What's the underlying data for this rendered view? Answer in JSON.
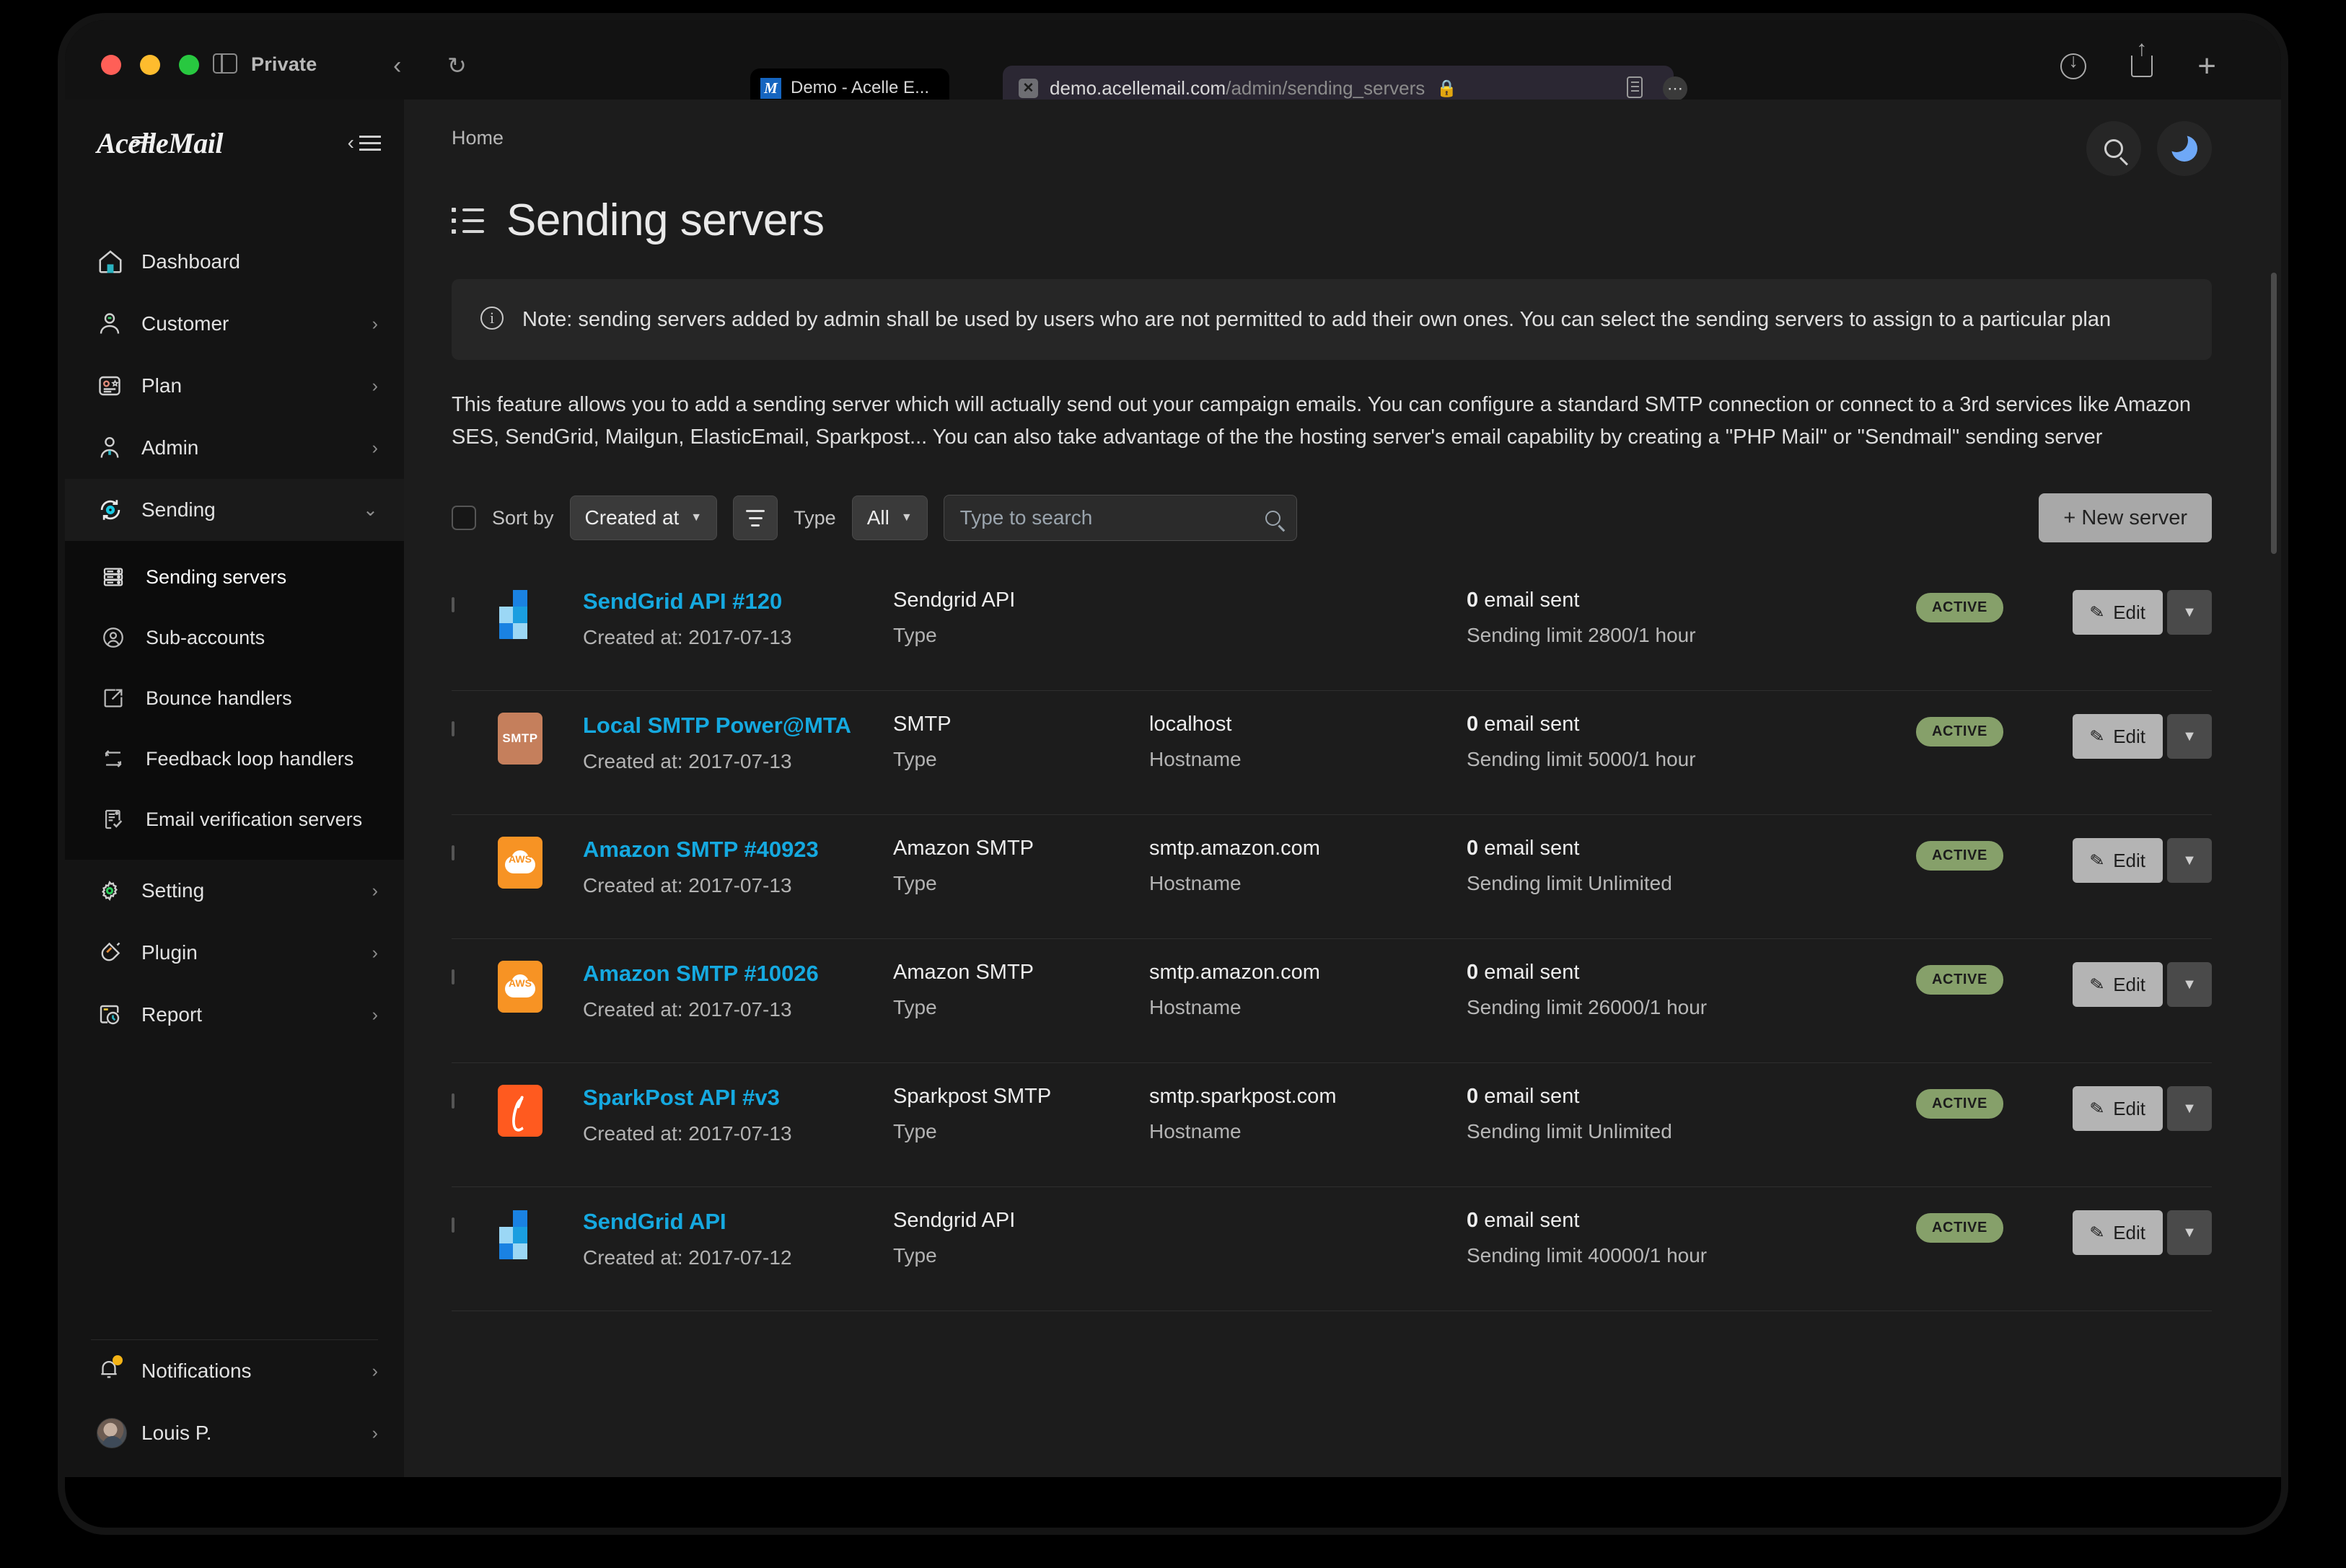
{
  "browser": {
    "private_label": "Private",
    "back_icon": "chevron-left-icon",
    "reload_icon": "reload-icon",
    "tab": {
      "title": "Demo - Acelle E...",
      "favicon_letter": "M"
    },
    "url": {
      "domain": "demo.acellemail.com",
      "path": "/admin/sending_servers",
      "lock_icon": "lock-icon"
    },
    "right_icons": [
      "download-icon",
      "share-icon",
      "plus-icon"
    ]
  },
  "sidebar": {
    "logo": "AcelleMail",
    "collapse_icon": "collapse-sidebar-icon",
    "items": [
      {
        "label": "Dashboard",
        "icon": "home-icon",
        "arrow": ""
      },
      {
        "label": "Customer",
        "icon": "user-icon",
        "arrow": "›"
      },
      {
        "label": "Plan",
        "icon": "plan-card-icon",
        "arrow": "›"
      },
      {
        "label": "Admin",
        "icon": "admin-user-icon",
        "arrow": "›"
      },
      {
        "label": "Sending",
        "icon": "sending-sync-icon",
        "arrow": "⌄"
      }
    ],
    "sub_items": [
      {
        "label": "Sending servers",
        "icon": "server-icon",
        "active": true
      },
      {
        "label": "Sub-accounts",
        "icon": "account-circle-icon",
        "active": false
      },
      {
        "label": "Bounce handlers",
        "icon": "bounce-icon",
        "active": false
      },
      {
        "label": "Feedback loop handlers",
        "icon": "loop-icon",
        "active": false
      },
      {
        "label": "Email verification servers",
        "icon": "verify-icon",
        "active": false
      }
    ],
    "items_after": [
      {
        "label": "Setting",
        "icon": "gear-icon",
        "arrow": "›"
      },
      {
        "label": "Plugin",
        "icon": "plug-icon",
        "arrow": "›"
      },
      {
        "label": "Report",
        "icon": "report-clock-icon",
        "arrow": "›"
      }
    ],
    "footer": [
      {
        "label": "Notifications",
        "icon": "bell-icon",
        "arrow": "›",
        "dot": true
      },
      {
        "label": "Louis P.",
        "icon": "avatar",
        "arrow": "›",
        "dot": false
      }
    ]
  },
  "header": {
    "breadcrumb": "Home",
    "title": "Sending servers",
    "title_icon": "list-icon",
    "search_icon": "search-icon",
    "theme_icon": "moon-icon"
  },
  "note": {
    "icon": "info-icon",
    "text": "Note: sending servers added by admin shall be used by users who are not permitted to add their own ones. You can select the sending servers to assign to a particular plan"
  },
  "intro": "This feature allows you to add a sending server which will actually send out your campaign emails. You can configure a standard SMTP connection or connect to a 3rd services like Amazon SES, SendGrid, Mailgun, ElasticEmail, Sparkpost... You can also take advantage of the the hosting server's email capability by creating a \"PHP Mail\" or \"Sendmail\" sending server",
  "toolbar": {
    "select_all_checkbox": "",
    "sort_by_label": "Sort by",
    "sort_by_value": "Created at",
    "sort_dir_icon": "sort-descending-icon",
    "type_label": "Type",
    "type_value": "All",
    "search_placeholder": "Type to search",
    "search_icon": "search-icon",
    "new_server_label": "+ New server"
  },
  "table": {
    "rows": [
      {
        "name": "SendGrid API #120",
        "created": "Created at: 2017-07-13",
        "type_value": "Sendgrid API",
        "type_label": "Type",
        "host_value": "",
        "host_label": "",
        "sent": "0",
        "sent_label": "email sent",
        "limit": "Sending limit 2800/1 hour",
        "status": "ACTIVE",
        "edit_label": "Edit",
        "logo": "sendgrid"
      },
      {
        "name": "Local SMTP Power@MTA",
        "created": "Created at: 2017-07-13",
        "type_value": "SMTP",
        "type_label": "Type",
        "host_value": "localhost",
        "host_label": "Hostname",
        "sent": "0",
        "sent_label": "email sent",
        "limit": "Sending limit 5000/1 hour",
        "status": "ACTIVE",
        "edit_label": "Edit",
        "logo": "smtp"
      },
      {
        "name": "Amazon SMTP #40923",
        "created": "Created at: 2017-07-13",
        "type_value": "Amazon SMTP",
        "type_label": "Type",
        "host_value": "smtp.amazon.com",
        "host_label": "Hostname",
        "sent": "0",
        "sent_label": "email sent",
        "limit": "Sending limit Unlimited",
        "status": "ACTIVE",
        "edit_label": "Edit",
        "logo": "aws"
      },
      {
        "name": "Amazon SMTP #10026",
        "created": "Created at: 2017-07-13",
        "type_value": "Amazon SMTP",
        "type_label": "Type",
        "host_value": "smtp.amazon.com",
        "host_label": "Hostname",
        "sent": "0",
        "sent_label": "email sent",
        "limit": "Sending limit 26000/1 hour",
        "status": "ACTIVE",
        "edit_label": "Edit",
        "logo": "aws"
      },
      {
        "name": "SparkPost API #v3",
        "created": "Created at: 2017-07-13",
        "type_value": "Sparkpost SMTP",
        "type_label": "Type",
        "host_value": "smtp.sparkpost.com",
        "host_label": "Hostname",
        "sent": "0",
        "sent_label": "email sent",
        "limit": "Sending limit Unlimited",
        "status": "ACTIVE",
        "edit_label": "Edit",
        "logo": "sparkpost"
      },
      {
        "name": "SendGrid API",
        "created": "Created at: 2017-07-12",
        "type_value": "Sendgrid API",
        "type_label": "Type",
        "host_value": "",
        "host_label": "",
        "sent": "0",
        "sent_label": "email sent",
        "limit": "Sending limit 40000/1 hour",
        "status": "ACTIVE",
        "edit_label": "Edit",
        "logo": "sendgrid"
      }
    ]
  },
  "colors": {
    "link": "#15a9e0",
    "badge_bg": "#86a06a",
    "accent_teal": "#2bb3c0",
    "sidebar_bg": "#141414",
    "main_bg": "#1c1c1c",
    "moon": "#6ea8f7"
  }
}
